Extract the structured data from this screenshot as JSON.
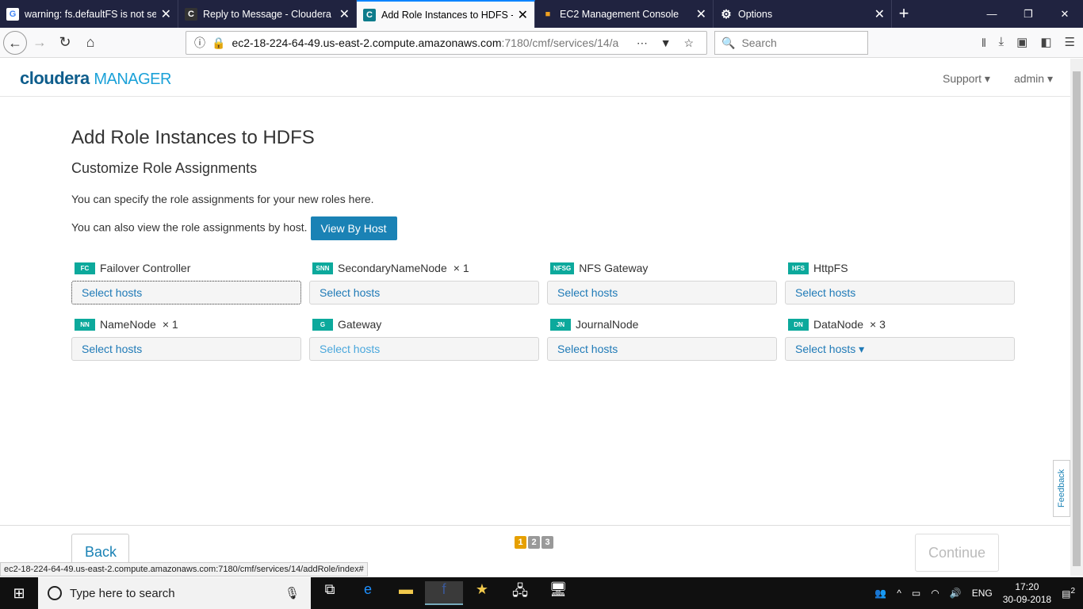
{
  "browser": {
    "tabs": [
      {
        "title": "warning: fs.defaultFS is not set",
        "icon": "G"
      },
      {
        "title": "Reply to Message - Cloudera Co",
        "icon": "C"
      },
      {
        "title": "Add Role Instances to HDFS - C",
        "icon": "C"
      },
      {
        "title": "EC2 Management Console",
        "icon": "■"
      },
      {
        "title": "Options",
        "icon": "⚙"
      }
    ],
    "url_host": "ec2-18-224-64-49.us-east-2.compute.amazonaws.com",
    "url_path": ":7180/cmf/services/14/a",
    "search_placeholder": "Search",
    "status_url": "ec2-18-224-64-49.us-east-2.compute.amazonaws.com:7180/cmf/services/14/addRole/index#"
  },
  "header": {
    "logo_main": "cloudera",
    "logo_sub": "MANAGER",
    "support": "Support ▾",
    "admin": "admin ▾"
  },
  "page": {
    "title": "Add Role Instances to HDFS",
    "subtitle": "Customize Role Assignments",
    "desc1": "You can specify the role assignments for your new roles here.",
    "desc2": "You can also view the role assignments by host.",
    "view_by_host": "View By Host",
    "roles": [
      {
        "badge": "FC",
        "name": "Failover Controller",
        "count": "",
        "select": "Select hosts"
      },
      {
        "badge": "SNN",
        "name": "SecondaryNameNode",
        "count": "× 1",
        "select": "Select hosts"
      },
      {
        "badge": "NFSG",
        "name": "NFS Gateway",
        "count": "",
        "select": "Select hosts"
      },
      {
        "badge": "HFS",
        "name": "HttpFS",
        "count": "",
        "select": "Select hosts"
      },
      {
        "badge": "NN",
        "name": "NameNode",
        "count": "× 1",
        "select": "Select hosts"
      },
      {
        "badge": "G",
        "name": "Gateway",
        "count": "",
        "select": "Select hosts"
      },
      {
        "badge": "JN",
        "name": "JournalNode",
        "count": "",
        "select": "Select hosts"
      },
      {
        "badge": "DN",
        "name": "DataNode",
        "count": "× 3",
        "select": "Select hosts ▾"
      }
    ]
  },
  "footer": {
    "back": "Back",
    "continue": "Continue",
    "pages": [
      "1",
      "2",
      "3"
    ],
    "feedback": "Feedback"
  },
  "taskbar": {
    "search": "Type here to search",
    "lang": "ENG",
    "time": "17:20",
    "date": "30-09-2018",
    "notifications": "2"
  }
}
